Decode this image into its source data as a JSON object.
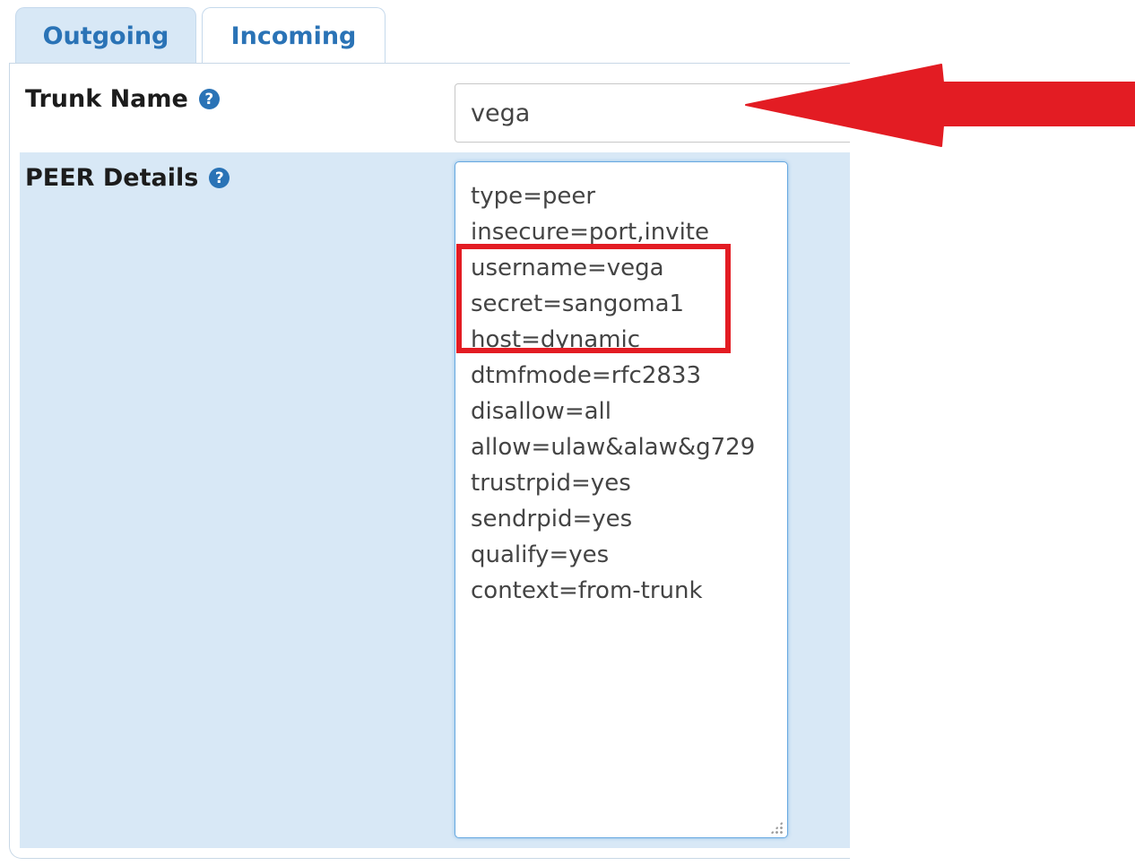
{
  "tabs": [
    {
      "label": "Outgoing"
    },
    {
      "label": "Incoming"
    }
  ],
  "trunk_name": {
    "label": "Trunk Name",
    "value": "vega",
    "help_icon": "question-circle-icon"
  },
  "peer_details": {
    "label": "PEER Details",
    "help_icon": "question-circle-icon",
    "lines": [
      "type=peer",
      "insecure=port,invite",
      "username=vega",
      "secret=sangoma1",
      "host=dynamic",
      "dtmfmode=rfc2833",
      "disallow=all",
      "allow=ulaw&alaw&g729",
      "trustrpid=yes",
      "sendrpid=yes",
      "qualify=yes",
      "context=from-trunk"
    ]
  },
  "annotations": {
    "arrow_color": "#e31c23",
    "highlight_color": "#e31c23"
  },
  "colors": {
    "accent": "#2a73b6",
    "active_tab_bg": "#d8e8f6",
    "row_highlight_bg": "#d8e8f6"
  }
}
